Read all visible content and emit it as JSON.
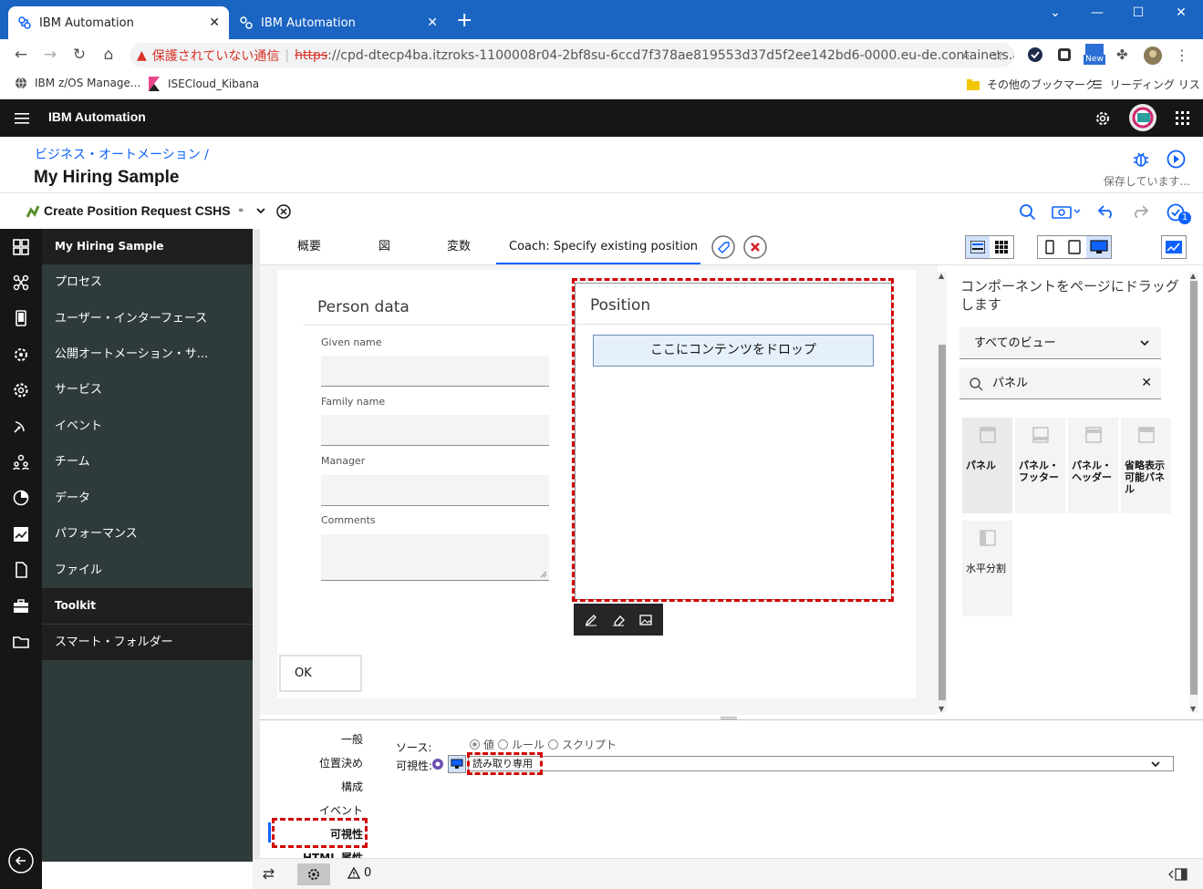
{
  "browser": {
    "tabs": [
      {
        "title": "IBM Automation",
        "active": true
      },
      {
        "title": "IBM Automation",
        "active": false
      }
    ],
    "new_tab": "+",
    "security_warning": "保護されていない通信",
    "url_scheme": "https",
    "url_rest": "://cpd-dtecp4ba.itzroks-1100008r04-2bf8su-6ccd7f378ae819553d37d5f2ee142bd6-0000.eu-de.containers.app...",
    "extension_badge": "New",
    "bookmarks": [
      "IBM z/OS Manage...",
      "ISECloud_Kibana"
    ],
    "other_bookmarks": "その他のブックマーク",
    "reading_list": "リーディング リスト"
  },
  "app": {
    "name": "IBM Automation",
    "breadcrumb": "ビジネス・オートメーション /",
    "project_title": "My Hiring Sample",
    "saving_status": "保存しています...",
    "service_name": "Create Position Request CSHS",
    "notification_count": "1"
  },
  "nav": {
    "items": [
      {
        "label": "My Hiring Sample",
        "icon": "dashboard-icon"
      },
      {
        "label": "プロセス",
        "icon": "process-icon"
      },
      {
        "label": "ユーザー・インターフェース",
        "icon": "mobile-icon"
      },
      {
        "label": "公開オートメーション・サ...",
        "icon": "gear-network-icon"
      },
      {
        "label": "サービス",
        "icon": "gear-icon"
      },
      {
        "label": "イベント",
        "icon": "satellite-icon"
      },
      {
        "label": "チーム",
        "icon": "team-icon"
      },
      {
        "label": "データ",
        "icon": "pie-icon"
      },
      {
        "label": "パフォーマンス",
        "icon": "chart-icon"
      },
      {
        "label": "ファイル",
        "icon": "file-icon"
      },
      {
        "label": "Toolkit",
        "icon": "toolbox-icon"
      },
      {
        "label": "スマート・フォルダー",
        "icon": "folder-icon"
      }
    ]
  },
  "editor": {
    "tabs": [
      "概要",
      "図",
      "変数"
    ],
    "coach_prefix": "Coach:",
    "coach_name": "Specify existing position"
  },
  "canvas": {
    "person_panel_title": "Person data",
    "fields": [
      "Given name",
      "Family name",
      "Manager",
      "Comments"
    ],
    "position_panel_title": "Position",
    "drop_hint": "ここにコンテンツをドロップ",
    "ok_button": "OK"
  },
  "palette": {
    "heading": "コンポーネントをページにドラッグします",
    "view_filter": "すべてのビュー",
    "search_value": "パネル",
    "components": [
      {
        "label": "パネル"
      },
      {
        "label": "パネル・\nフッター"
      },
      {
        "label": "パネル・\nヘッダー"
      },
      {
        "label": "省略表示\n可能パネ\nル"
      },
      {
        "label": "水平分割"
      }
    ]
  },
  "properties": {
    "sections": [
      "一般",
      "位置決め",
      "構成",
      "イベント",
      "可視性",
      "HTML 属性"
    ],
    "source_label": "ソース:",
    "source_options": [
      "値",
      "ルール",
      "スクリプト"
    ],
    "visibility_label": "可視性:",
    "visibility_value": "読み取り専用"
  },
  "statusbar": {
    "warning_count": "0"
  },
  "colors": {
    "chrome_blue": "#1a64c2",
    "app_header": "#161616",
    "nav_panel": "#2f3b3b",
    "accent": "#0f62fe",
    "highlight_red": "#d20000"
  }
}
